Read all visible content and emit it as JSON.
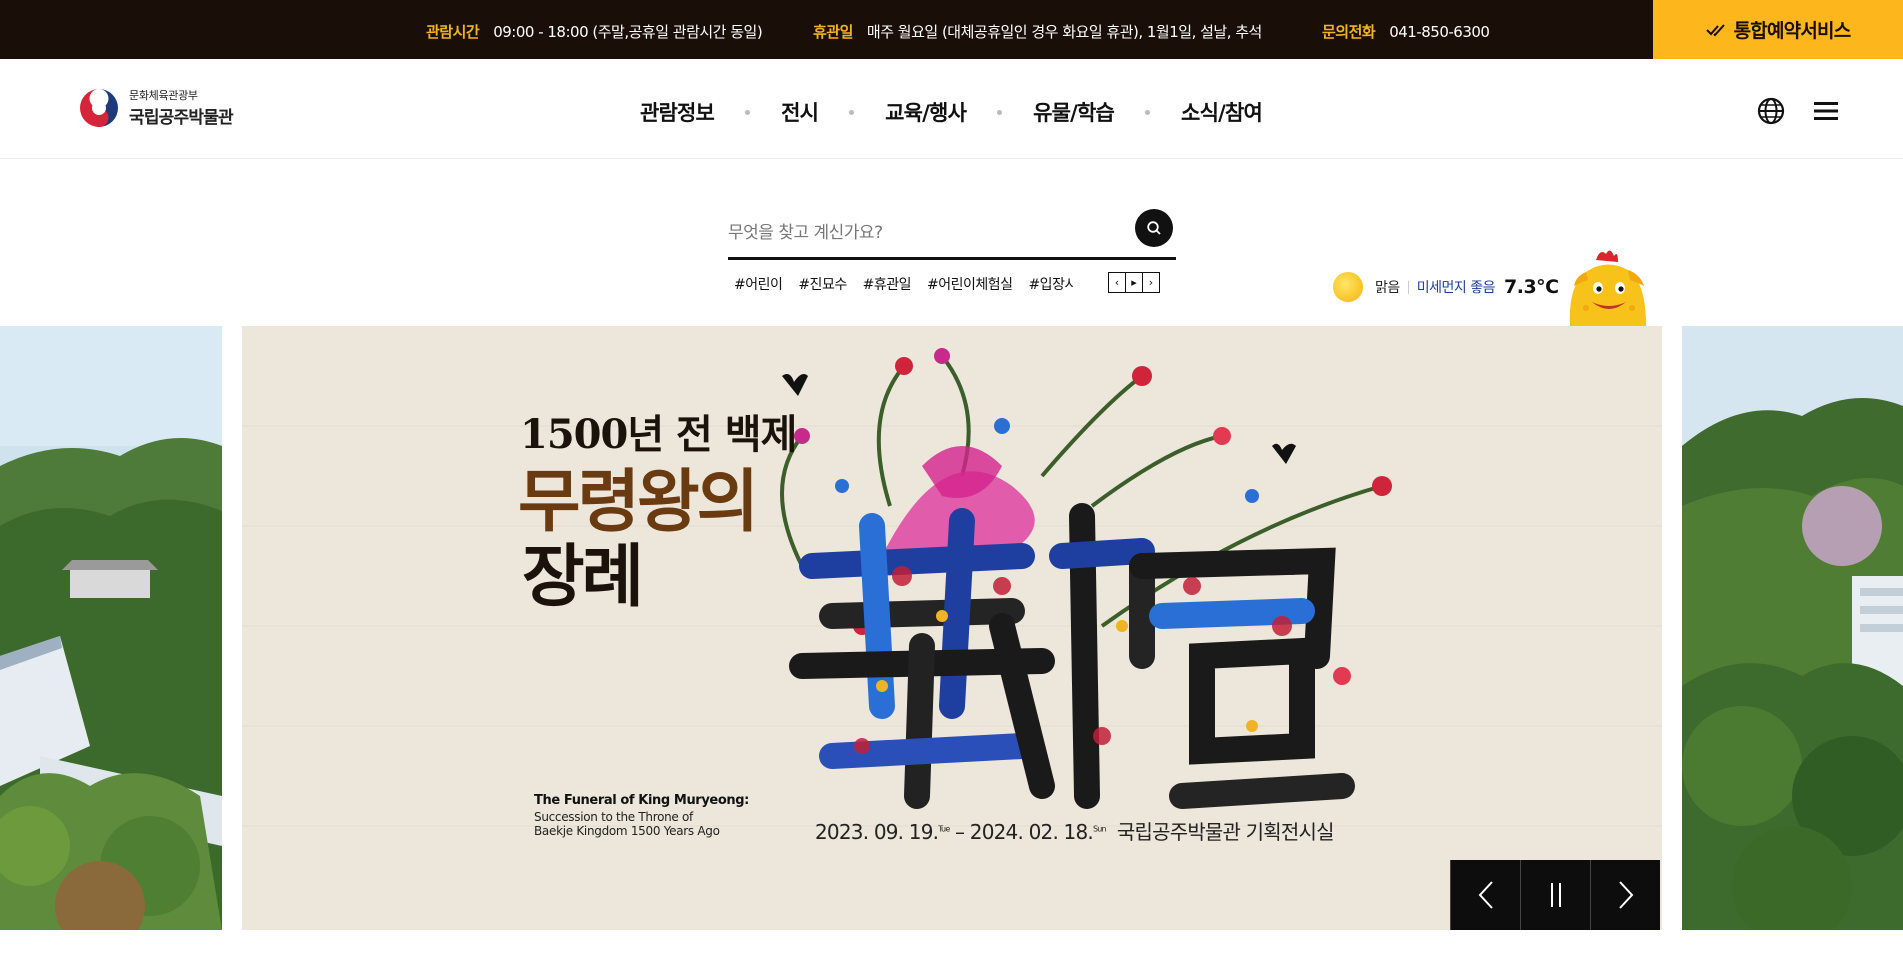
{
  "topbar": {
    "hours_label": "관람시간",
    "hours_value": "09:00 - 18:00 (주말,공휴일 관람시간 동일)",
    "closed_label": "휴관일",
    "closed_value": "매주 월요일 (대체공휴일인 경우 화요일 휴관), 1월1일, 설날, 추석",
    "phone_label": "문의전화",
    "phone_value": "041-850-6300",
    "reserve_label": "통합예약서비스"
  },
  "header": {
    "logo_small": "문화체육관광부",
    "logo_big": "국립공주박물관",
    "nav": [
      "관람정보",
      "전시",
      "교육/행사",
      "유물/학습",
      "소식/참여"
    ]
  },
  "search": {
    "placeholder": "무엇을 찾고 계신가요?",
    "tags": [
      "#어린이",
      "#진묘수",
      "#휴관일",
      "#어린이체험실",
      "#입장시"
    ]
  },
  "weather": {
    "condition": "맑음",
    "dust": "미세먼지 좋음",
    "temperature": "7.3°C"
  },
  "banner": {
    "title_line1": "1500년 전 백제",
    "title_line2": "무령왕의",
    "title_line3": "장례",
    "english_title": "The Funeral of King Muryeong:",
    "english_sub": "Succession to the Throne of Baekje Kingdom 1500 Years Ago",
    "date_start": "2023. 09. 19.",
    "date_start_day": "Tue",
    "date_end": "2024. 02. 18.",
    "date_end_day": "Sun",
    "venue": "국립공주박물관 기획전시실",
    "calligraphy": "葬禮"
  },
  "colors": {
    "topbar_bg": "#1a0f08",
    "accent_yellow": "#fdb61b",
    "label_gold": "#f2b320",
    "dust_blue": "#1f3fa0"
  }
}
